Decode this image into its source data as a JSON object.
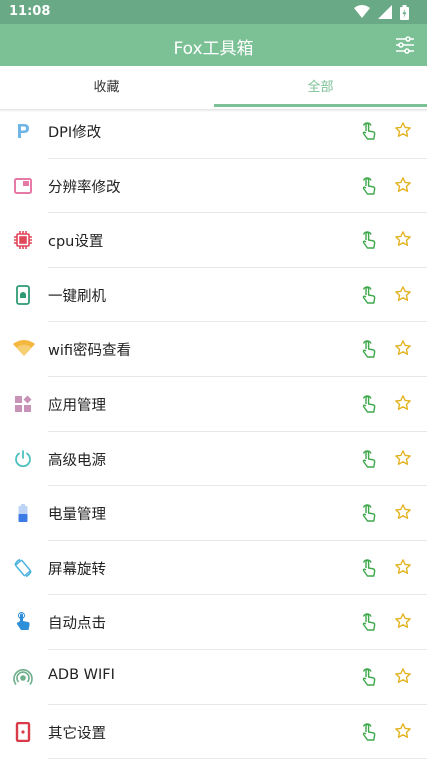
{
  "status_bar": {
    "time": "11:08"
  },
  "app_bar": {
    "title": "Fox工具箱"
  },
  "tabs": [
    {
      "label": "收藏",
      "selected": false
    },
    {
      "label": "全部",
      "selected": true
    }
  ],
  "colors": {
    "primary": "#7cc196",
    "status_bar": "#6aa985",
    "touch_icon": "#3ea84a",
    "star": "#e3b21f"
  },
  "tools": [
    {
      "label": "DPI修改",
      "icon": "p-letter-icon"
    },
    {
      "label": "分辨率修改",
      "icon": "window-icon"
    },
    {
      "label": "cpu设置",
      "icon": "cpu-chip-icon"
    },
    {
      "label": "一键刷机",
      "icon": "phone-android-icon"
    },
    {
      "label": "wifi密码查看",
      "icon": "wifi-icon"
    },
    {
      "label": "应用管理",
      "icon": "apps-grid-icon"
    },
    {
      "label": "高级电源",
      "icon": "power-icon"
    },
    {
      "label": "电量管理",
      "icon": "battery-icon"
    },
    {
      "label": "屏幕旋转",
      "icon": "screen-rotation-icon"
    },
    {
      "label": "自动点击",
      "icon": "touch-app-icon"
    },
    {
      "label": "ADB WIFI",
      "icon": "adb-wifi-icon"
    },
    {
      "label": "其它设置",
      "icon": "other-settings-icon"
    }
  ]
}
